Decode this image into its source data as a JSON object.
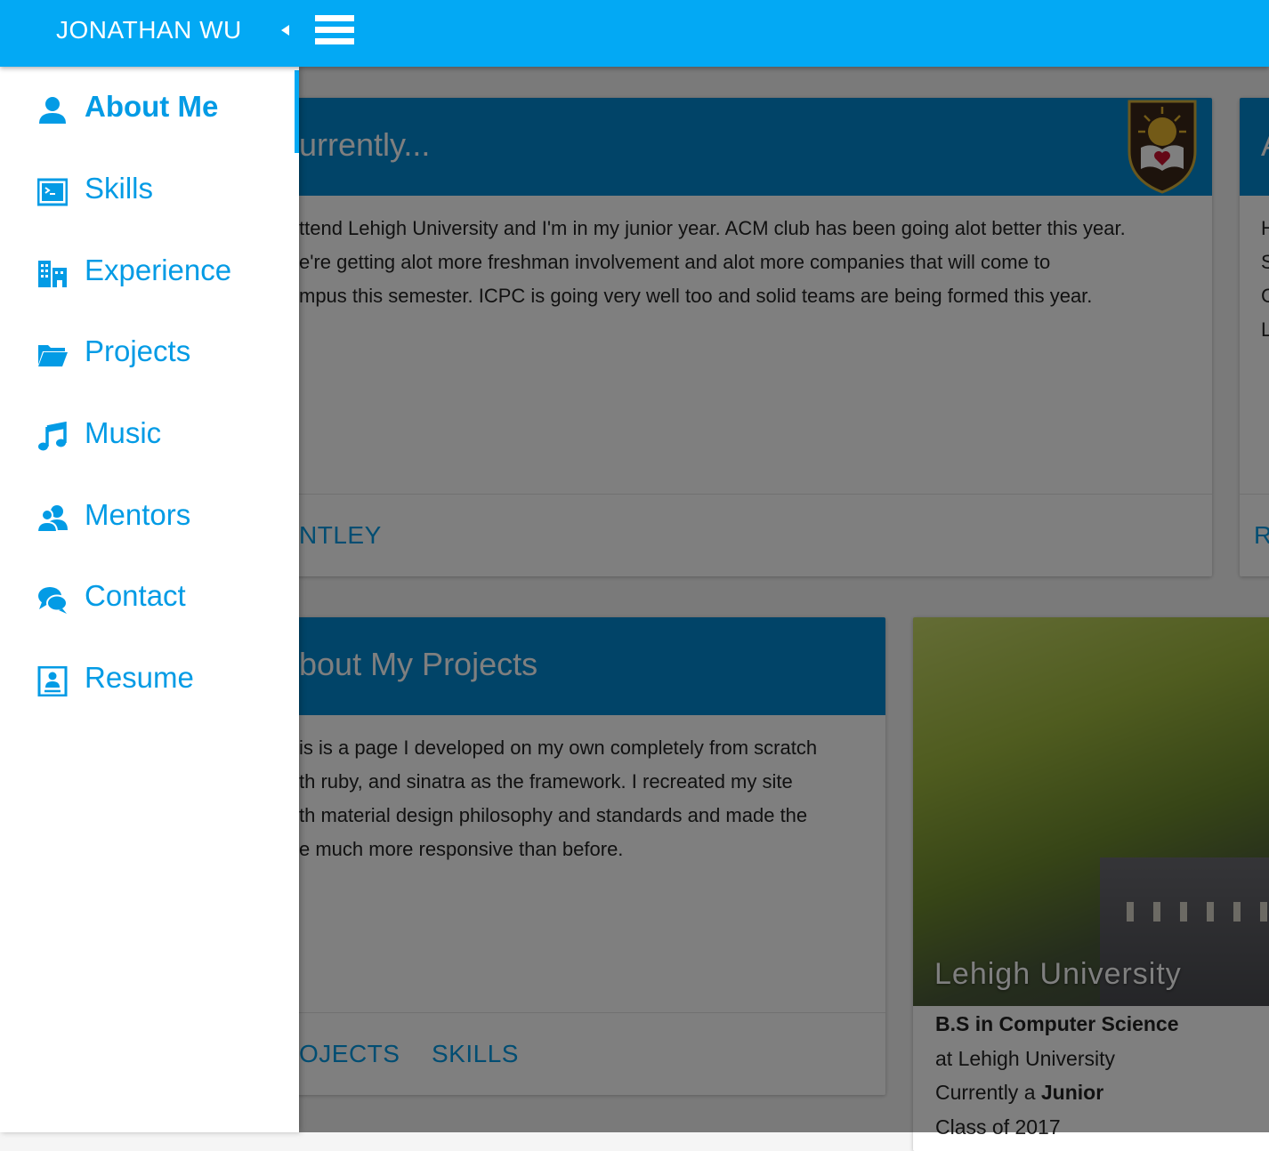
{
  "header": {
    "brand": "JONATHAN WU"
  },
  "nav": {
    "items": [
      {
        "label": "About Me",
        "icon": "person-icon",
        "active": true
      },
      {
        "label": "Skills",
        "icon": "terminal-icon"
      },
      {
        "label": "Experience",
        "icon": "building-icon"
      },
      {
        "label": "Projects",
        "icon": "folder-icon"
      },
      {
        "label": "Music",
        "icon": "music-note-icon"
      },
      {
        "label": "Mentors",
        "icon": "people-icon"
      },
      {
        "label": "Contact",
        "icon": "chat-bubbles-icon"
      },
      {
        "label": "Resume",
        "icon": "document-icon"
      }
    ]
  },
  "currently_card": {
    "title": "urrently...",
    "lines": [
      "ttend Lehigh University and I'm in my junior year. ACM club has been going alot better this year.",
      "e're getting alot more freshman involvement and alot more companies that will come to",
      "mpus this semester. ICPC is going very well too and solid teams are being formed this year."
    ],
    "action": "NTLEY"
  },
  "right_card": {
    "title": "A",
    "lines": [
      "H",
      "S",
      "C",
      "L"
    ],
    "action": "R"
  },
  "projects_card": {
    "title": "bout My Projects",
    "lines": [
      "is is a page I developed on my own completely from scratch",
      "th ruby, and sinatra as the framework. I recreated my site",
      "th material design philosophy and standards and made the",
      "e much more responsive than before."
    ],
    "actions": [
      "OJECTS",
      "SKILLS"
    ]
  },
  "university_card": {
    "photo_label": "Lehigh University",
    "degree": "B.S in Computer Science",
    "school": "at Lehigh University",
    "currently_prefix": "Currently a ",
    "year": "Junior",
    "class_of": "Class of 2017"
  },
  "colors": {
    "appbar": "#03a9f4",
    "card_header": "#0288d1",
    "link": "#039be5",
    "overlay": "rgba(0,0,0,0.5)"
  }
}
